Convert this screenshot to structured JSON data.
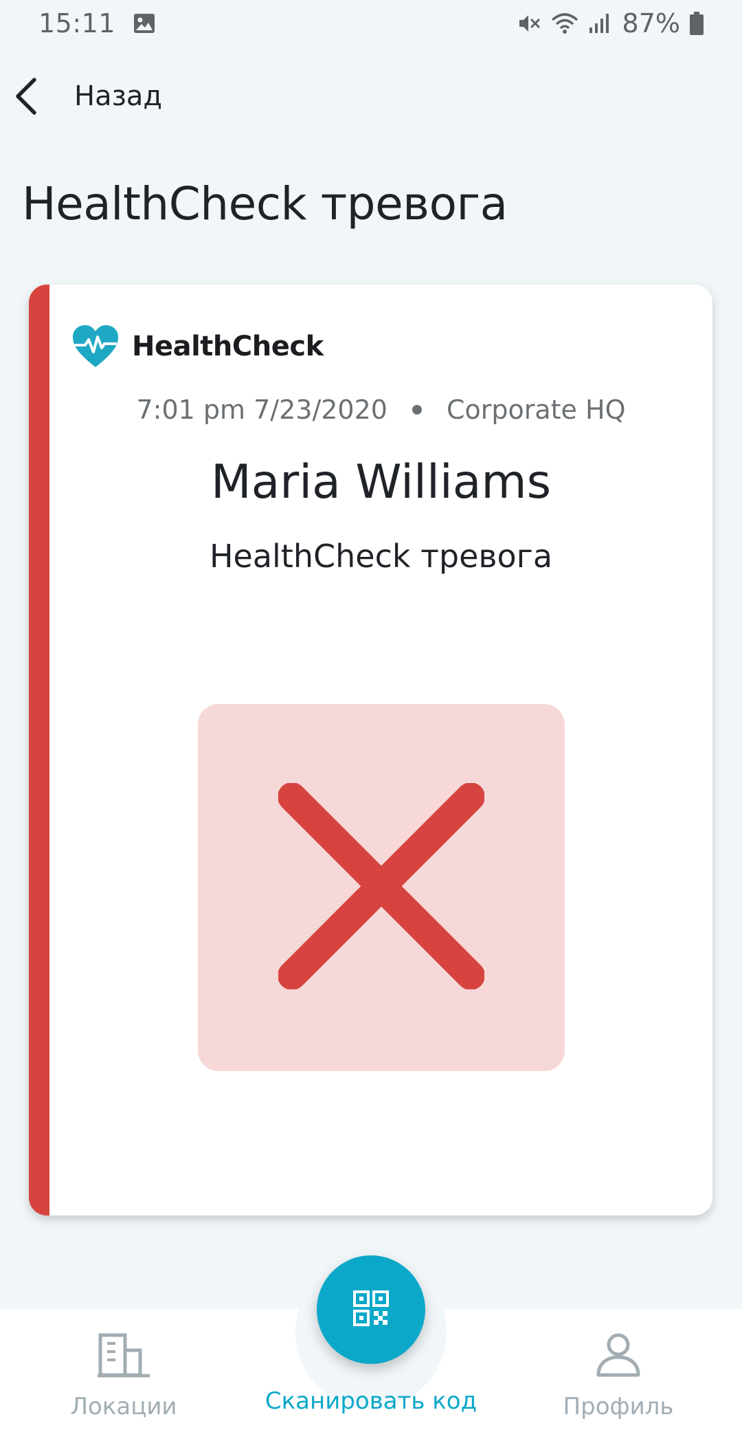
{
  "status_bar": {
    "time": "15:11",
    "battery": "87%",
    "icons": [
      "gallery-icon",
      "mute-icon",
      "wifi-icon",
      "signal-icon",
      "battery-icon"
    ]
  },
  "header": {
    "back_label": "Назад",
    "title": "HealthCheck тревога"
  },
  "card": {
    "brand_name": "HealthCheck",
    "timestamp": "7:01 pm 7/23/2020",
    "location": "Corporate HQ",
    "person_name": "Maria Williams",
    "alert_type": "HealthCheck тревога",
    "status": "failed",
    "accent_color": "#d7443f",
    "status_bg_color": "#f7d8d8"
  },
  "bottom_nav": {
    "items": [
      {
        "label": "Локации",
        "icon": "building-icon"
      },
      {
        "label": "Сканировать код",
        "icon": "qr-code-icon"
      },
      {
        "label": "Профиль",
        "icon": "person-icon"
      }
    ],
    "active_color": "#0ba8c9",
    "inactive_color": "#a2adb3"
  }
}
